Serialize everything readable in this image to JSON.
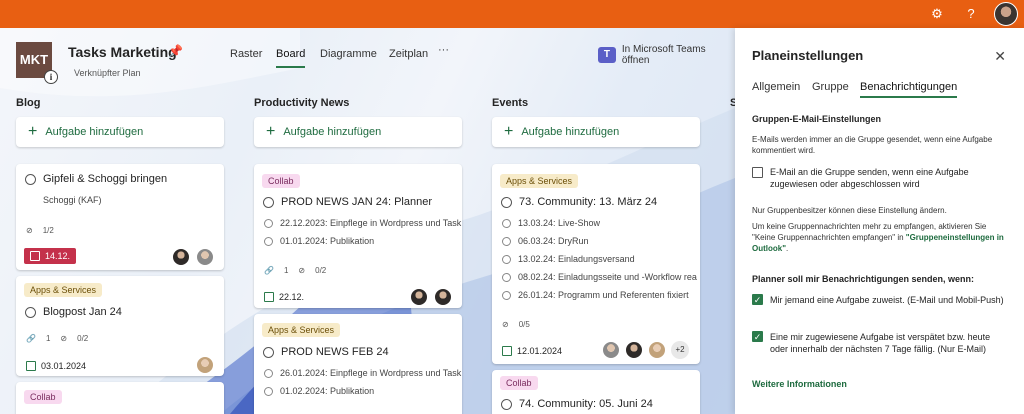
{
  "topbar": {
    "settings_icon": "gear-icon",
    "help_label": "?",
    "accent": "#e85f12"
  },
  "header": {
    "logo_text": "MKT",
    "plan_title": "Tasks Marketing",
    "plan_subtitle": "Verknüpfter Plan",
    "nav": [
      "Raster",
      "Board",
      "Diagramme",
      "Zeitplan"
    ],
    "more": "···",
    "teams_label": "In Microsoft Teams öffnen"
  },
  "columns": [
    {
      "title": "Blog",
      "add_label": "Aufgabe hinzufügen",
      "cards": [
        {
          "title": "Gipfeli & Schoggi bringen",
          "subtitle": "Schoggi (KAF)",
          "checklist": "1/2",
          "date": "14.12."
        },
        {
          "label": "Apps & Services",
          "title": "Blogpost Jan 24",
          "attachments": "1",
          "checklist": "0/2",
          "date": "03.01.2024"
        },
        {
          "label": "Collab"
        }
      ]
    },
    {
      "title": "Productivity News",
      "add_label": "Aufgabe hinzufügen",
      "cards": [
        {
          "label": "Collab",
          "title": "PROD NEWS JAN 24: Planner",
          "items": [
            "22.12.2023: Einpflege in Wordpress und Task",
            "01.01.2024: Publikation"
          ],
          "attachments": "1",
          "checklist": "0/2",
          "date": "22.12."
        },
        {
          "label": "Apps & Services",
          "title": "PROD NEWS FEB 24",
          "items": [
            "26.01.2024: Einpflege in Wordpress und Task",
            "01.02.2024: Publikation"
          ]
        }
      ]
    },
    {
      "title": "Events",
      "add_label": "Aufgabe hinzufügen",
      "cards": [
        {
          "label": "Apps & Services",
          "title": "73. Community: 13. März 24",
          "items": [
            "13.03.24: Live-Show",
            "06.03.24: DryRun",
            "13.02.24: Einladungsversand",
            "08.02.24: Einladungsseite und -Workflow rea",
            "26.01.24: Programm und Referenten fixiert"
          ],
          "checklist": "0/5",
          "date": "12.01.2024",
          "more_assignees": "+2"
        },
        {
          "label": "Collab",
          "title": "74. Community: 05. Juni 24"
        }
      ]
    },
    {
      "title": "S"
    }
  ],
  "panel": {
    "title": "Planeinstellungen",
    "close": "✕",
    "tabs": [
      "Allgemein",
      "Gruppe",
      "Benachrichtigungen"
    ],
    "section1": "Gruppen-E-Mail-Einstellungen",
    "info1": "E-Mails werden immer an die Gruppe gesendet, wenn eine Aufgabe kommentiert wird.",
    "opt1": "E-Mail an die Gruppe senden, wenn eine Aufgabe zugewiesen oder abgeschlossen wird",
    "info2": "Nur Gruppenbesitzer können diese Einstellung ändern.",
    "info3": "Um keine Gruppennachrichten mehr zu empfangen, aktivieren Sie \"Keine Gruppennachrichten empfangen\" in ",
    "info3_link": "\"Gruppeneinstellungen in Outlook\"",
    "info3_end": ".",
    "section2": "Planner soll mir Benachrichtigungen senden, wenn:",
    "opt2": "Mir jemand eine Aufgabe zuweist. (E-Mail und Mobil-Push)",
    "opt3": "Eine mir zugewiesene Aufgabe ist verspätet bzw. heute oder innerhalb der nächsten 7 Tage fällig. (Nur E-Mail)",
    "more_info": "Weitere Informationen"
  }
}
